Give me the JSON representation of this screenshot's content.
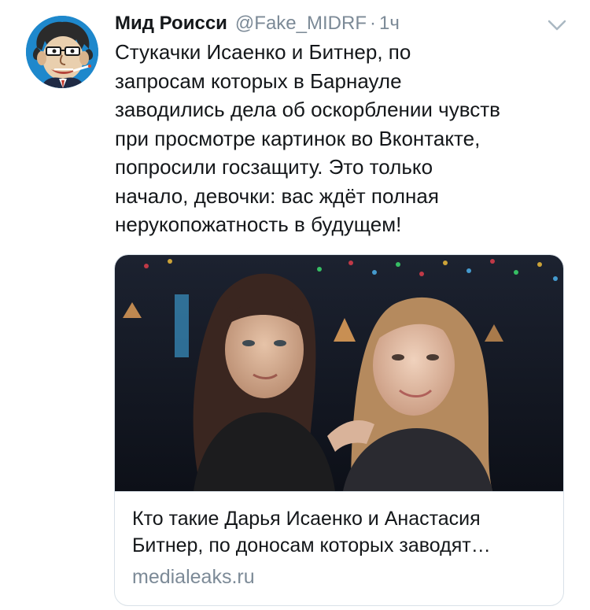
{
  "tweet": {
    "author_name": "Мид Роисси",
    "handle": "@Fake_MIDRF",
    "separator": "·",
    "time": "1ч",
    "text": "Стукачки Исаенко и Битнер, по\nзапросам которых в Барнауле\nзаводились дела об оскорблении чувств\nпри просмотре картинок во Вконтакте,\nпопросили госзащиту. Это только\nначало, девочки: вас ждёт полная\nнерукопожатность в будущем!"
  },
  "card": {
    "title": "Кто такие Дарья Исаенко и Анастасия Битнер, по доносам которых заводят…",
    "domain": "medialeaks.ru"
  },
  "icons": {
    "menu": "chevron-down-icon",
    "avatar": "caricature-avatar"
  },
  "colors": {
    "text": "#14171a",
    "secondary": "#7c8a97",
    "border": "#d9e1e8"
  }
}
